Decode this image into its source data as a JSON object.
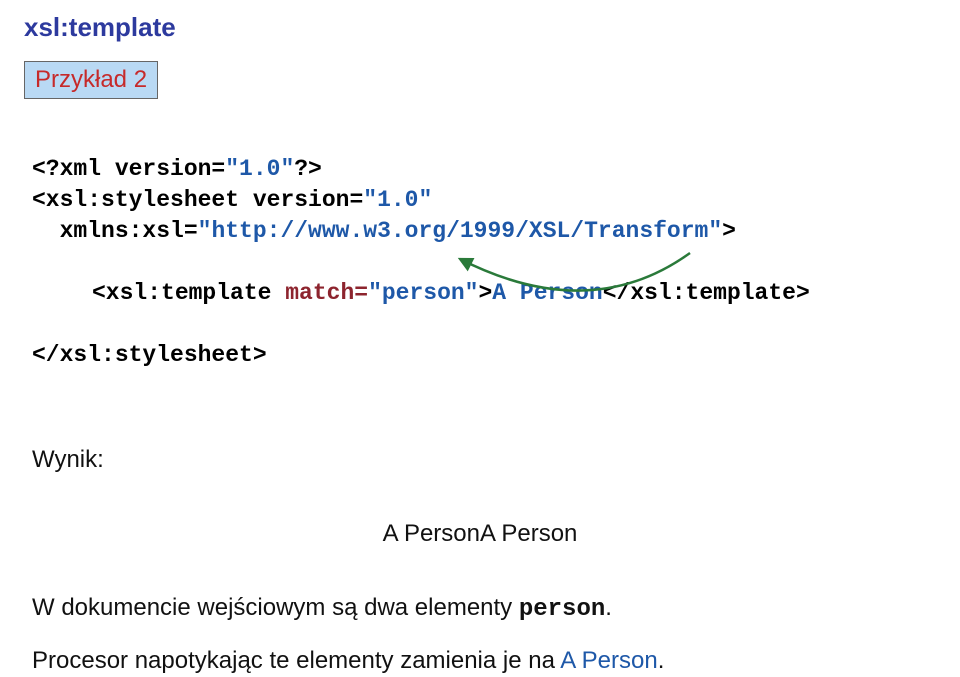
{
  "title": "xsl:template",
  "badge": "Przykład 2",
  "code": {
    "line1a": "<?xml version=",
    "line1b": "\"1.0\"",
    "line1c": "?>",
    "line2a": "<xsl:stylesheet version=",
    "line2b": "\"1.0\"",
    "line3a": "xmlns:xsl=",
    "line3b": "\"http://www.w3.org/1999/XSL/Transform\"",
    "line3c": ">",
    "line4a": "<xsl:template ",
    "line4b": "match=",
    "line4c": "\"person\"",
    "line4d": ">",
    "line4e": "A Person",
    "line4f": "</xsl:template>",
    "line5": "</xsl:stylesheet>"
  },
  "result_label": "Wynik:",
  "result_text": "A PersonA Person",
  "para1_a": "W dokumencie wejściowym są dwa elementy ",
  "para1_b": "person",
  "para1_c": ".",
  "para2_a": "Procesor napotykając te elementy zamienia je na ",
  "para2_b": "A Person",
  "para2_c": "."
}
